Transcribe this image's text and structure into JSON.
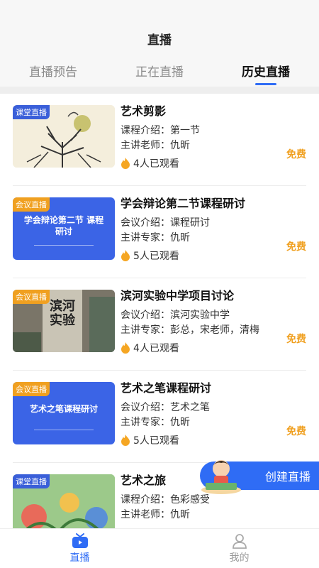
{
  "header": {
    "title": "直播"
  },
  "tabs": [
    {
      "label": "直播预告",
      "active": false
    },
    {
      "label": "正在直播",
      "active": false
    },
    {
      "label": "历史直播",
      "active": true
    }
  ],
  "items": [
    {
      "badge": "课堂直播",
      "badge_type": "classroom",
      "title": "艺术剪影",
      "line1": "课程介绍：第一节",
      "line2": "主讲老师：仇昕",
      "viewers": "4人已观看",
      "price": "免费",
      "thumb": "art-silhouette"
    },
    {
      "badge": "会议直播",
      "badge_type": "meeting",
      "title": "学会辩论第二节课程研讨",
      "line1": "会议介绍：课程研讨",
      "line2": "主讲专家：仇昕",
      "viewers": "5人已观看",
      "price": "免费",
      "thumb": "blue-banner",
      "thumb_text": "学会辩论第二节 课程研讨"
    },
    {
      "badge": "会议直播",
      "badge_type": "meeting",
      "title": "滨河实验中学项目讨论",
      "line1": "会议介绍：滨河实验中学",
      "line2": "主讲专家：彭总，宋老师，清梅",
      "viewers": "4人已观看",
      "price": "免费",
      "thumb": "school-sign",
      "thumb_text": "滨河实验"
    },
    {
      "badge": "会议直播",
      "badge_type": "meeting",
      "title": "艺术之笔课程研讨",
      "line1": "会议介绍：艺术之笔",
      "line2": "主讲专家：仇昕",
      "viewers": "5人已观看",
      "price": "免费",
      "thumb": "blue-banner",
      "thumb_text": "艺术之笔课程研讨"
    },
    {
      "badge": "课堂直播",
      "badge_type": "classroom",
      "title": "艺术之旅",
      "line1": "课程介绍：色彩感受",
      "line2": "主讲老师：仇昕",
      "viewers": "",
      "price": "",
      "thumb": "colorful-painting"
    }
  ],
  "fab": {
    "label": "创建直播"
  },
  "tabbar": [
    {
      "label": "直播",
      "active": true
    },
    {
      "label": "我的",
      "active": false
    }
  ],
  "colors": {
    "accent": "#2f6cf5",
    "price": "#f0a020",
    "badge_classroom": "#3a5fd9",
    "badge_meeting": "#f0a020"
  }
}
